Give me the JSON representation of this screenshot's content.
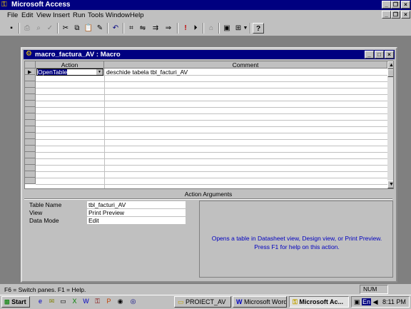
{
  "app": {
    "title": "Microsoft Access"
  },
  "menu": [
    "File",
    "Edit",
    "View",
    "Insert",
    "Run",
    "Tools",
    "Window",
    "Help"
  ],
  "window": {
    "title": "macro_factura_AV : Macro"
  },
  "grid": {
    "columns": [
      "Action",
      "Comment"
    ],
    "rows": [
      {
        "action": "OpenTable",
        "comment": "deschide tabela tbl_facturi_AV"
      }
    ]
  },
  "args": {
    "title": "Action Arguments",
    "fields": [
      {
        "label": "Table Name",
        "value": "tbl_facturi_AV"
      },
      {
        "label": "View",
        "value": "Print Preview"
      },
      {
        "label": "Data Mode",
        "value": "Edit"
      }
    ],
    "help": "Opens a table in Datasheet view, Design view, or Print Preview. Press F1 for help on this action."
  },
  "status": {
    "text": "F6 = Switch panes.  F1 = Help.",
    "num": "NUM"
  },
  "taskbar": {
    "start": "Start",
    "tasks": [
      "PROIECT_AV",
      "Microsoft Word ...",
      "Microsoft Ac..."
    ],
    "lang": "En",
    "clock": "8:11 PM"
  },
  "colors": {
    "titlebar": "#000080",
    "face": "#c0c0c0",
    "help_text": "#0000c0"
  }
}
